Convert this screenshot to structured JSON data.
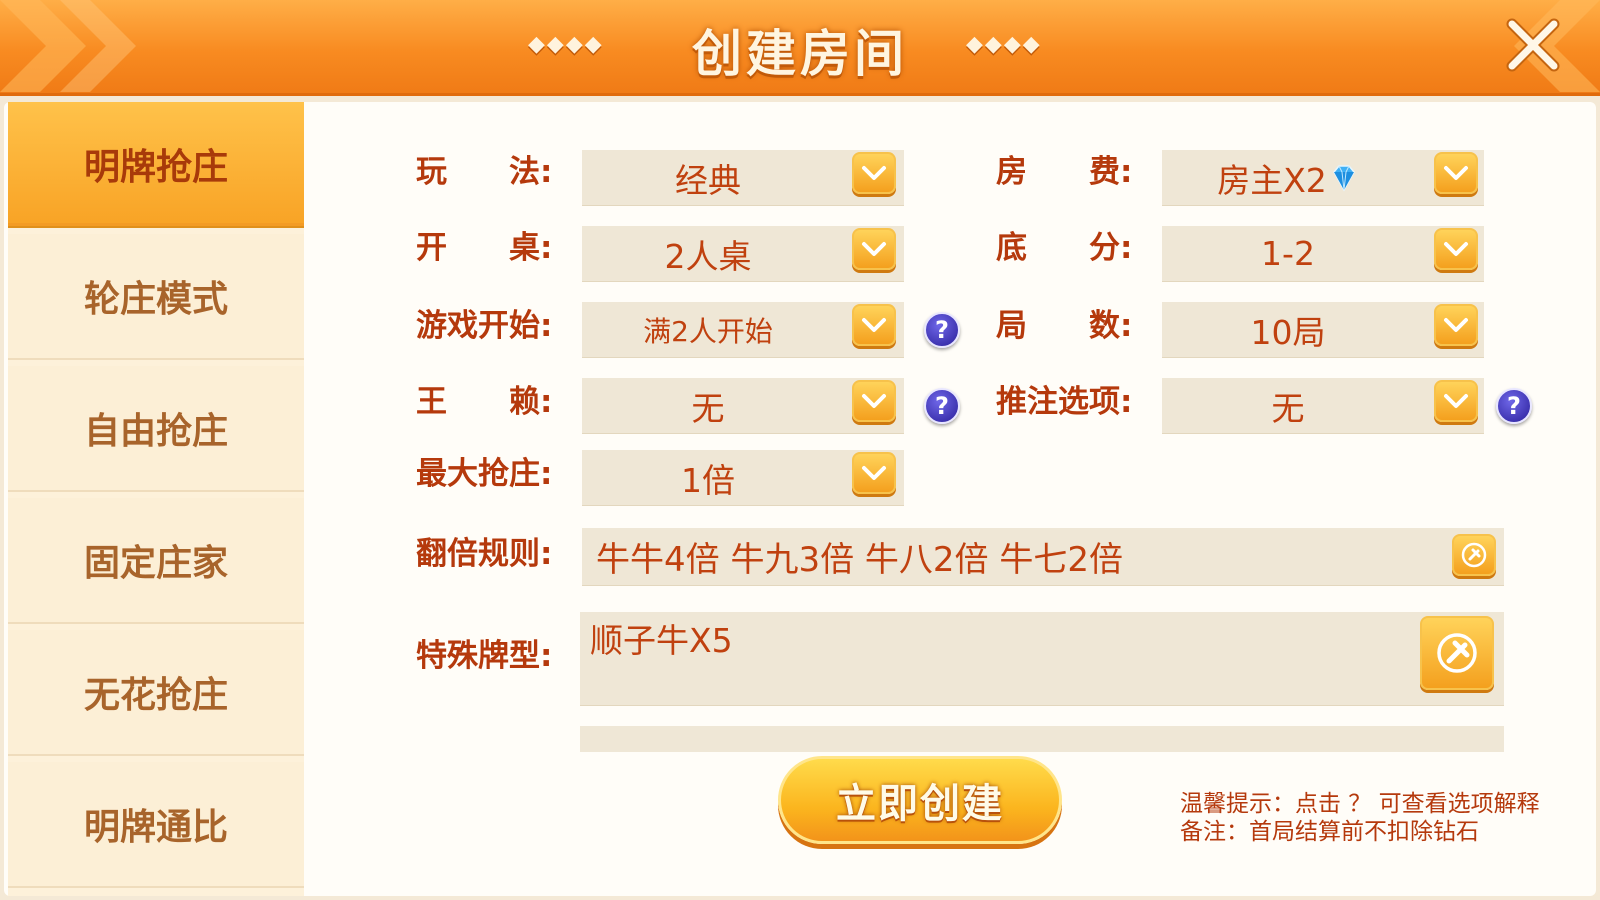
{
  "title": {
    "text": "创建房间",
    "deco_left": "◆◆◆◆",
    "deco_right": "◆◆◆◆"
  },
  "sidebar": {
    "tabs": [
      {
        "label": "明牌抢庄",
        "active": true
      },
      {
        "label": "轮庄模式",
        "active": false
      },
      {
        "label": "自由抢庄",
        "active": false
      },
      {
        "label": "固定庄家",
        "active": false
      },
      {
        "label": "无花抢庄",
        "active": false
      },
      {
        "label": "明牌通比",
        "active": false
      }
    ]
  },
  "form": {
    "play_mode": {
      "label": "玩　　法:",
      "value": "经典"
    },
    "room_fee": {
      "label": "房　　费:",
      "value": "房主X2"
    },
    "table": {
      "label": "开　　桌:",
      "value": "2人桌"
    },
    "base_score": {
      "label": "底　　分:",
      "value": "1-2"
    },
    "game_start": {
      "label": "游戏开始:",
      "value": "满2人开始"
    },
    "rounds": {
      "label": "局　　数:",
      "value": "10局"
    },
    "wild": {
      "label": "王　　赖:",
      "value": "无"
    },
    "push_bet": {
      "label": "推注选项:",
      "value": "无"
    },
    "max_grab": {
      "label": "最大抢庄:",
      "value": "1倍"
    },
    "double_rule": {
      "label": "翻倍规则:",
      "value": "牛牛4倍 牛九3倍 牛八2倍 牛七2倍"
    },
    "special": {
      "label": "特殊牌型:",
      "value": "顺子牛X5"
    }
  },
  "create_button": {
    "label": "立即创建"
  },
  "tips": {
    "line1": "温馨提示：点击 ？ 可查看选项解释",
    "line2": "备注：首局结算前不扣除钻石"
  },
  "colors": {
    "accent": "#f88b21",
    "label": "#b5390c",
    "field_bg": "#efe7d6"
  }
}
